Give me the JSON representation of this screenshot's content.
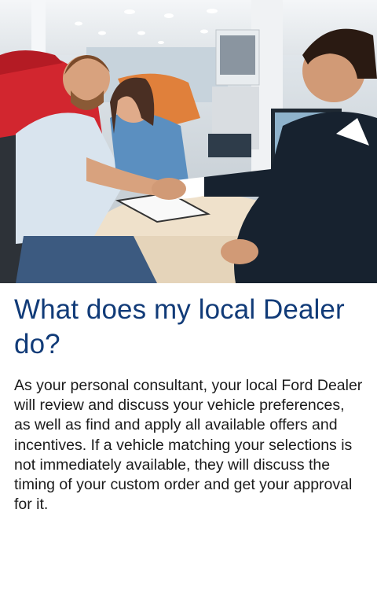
{
  "hero": {
    "alt": "Customers shaking hands with a dealer at a desk in a car showroom"
  },
  "article": {
    "title": "What does my local Dealer do?",
    "body": "As your personal consultant, your local Ford Dealer will review and discuss your vehicle preferences, as well as find and apply all available offers and incentives. If a vehicle matching your selections is not immediately available, they will discuss the timing of your custom order and get your approval for it."
  },
  "colors": {
    "title": "#113b78",
    "body_text": "#1b1b1b",
    "background": "#ffffff"
  }
}
